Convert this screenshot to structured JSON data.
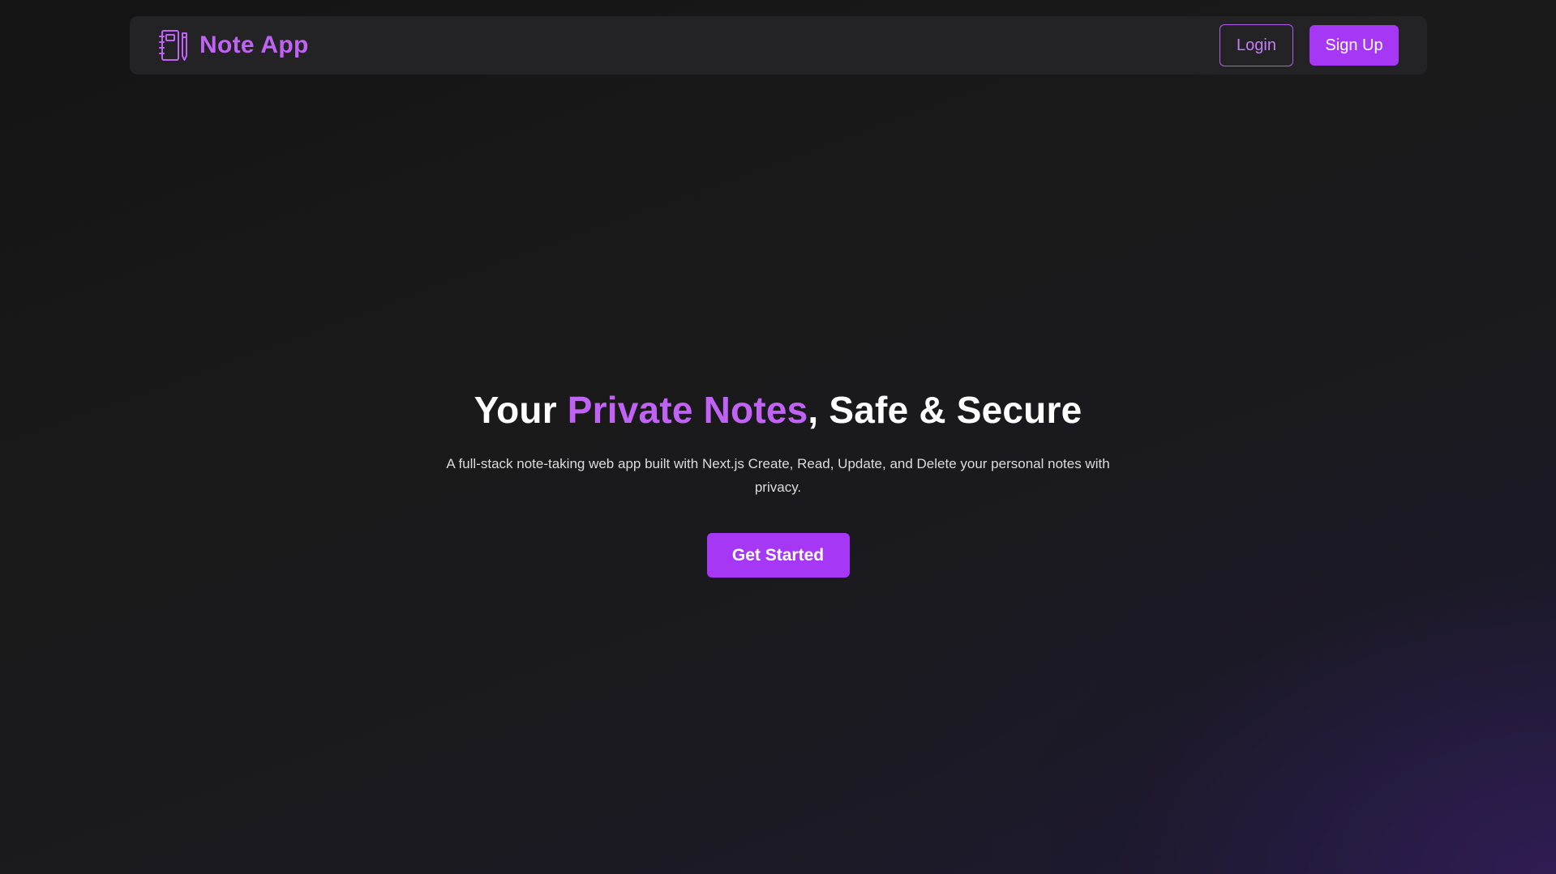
{
  "navbar": {
    "brand_icon": "notebook-pencil-icon",
    "brand_name": "Note App",
    "login_label": "Login",
    "signup_label": "Sign Up"
  },
  "hero": {
    "title_prefix": "Your ",
    "title_highlight": "Private Notes",
    "title_suffix": ", Safe & Secure",
    "subtitle": "A full-stack note-taking web app built with Next.js Create, Read, Update, and Delete your personal notes with privacy.",
    "cta_label": "Get Started"
  },
  "colors": {
    "accent": "#a537f5",
    "accent_text": "#c063f5",
    "navbar_bg": "#232326",
    "page_bg": "#1a1a1a"
  }
}
